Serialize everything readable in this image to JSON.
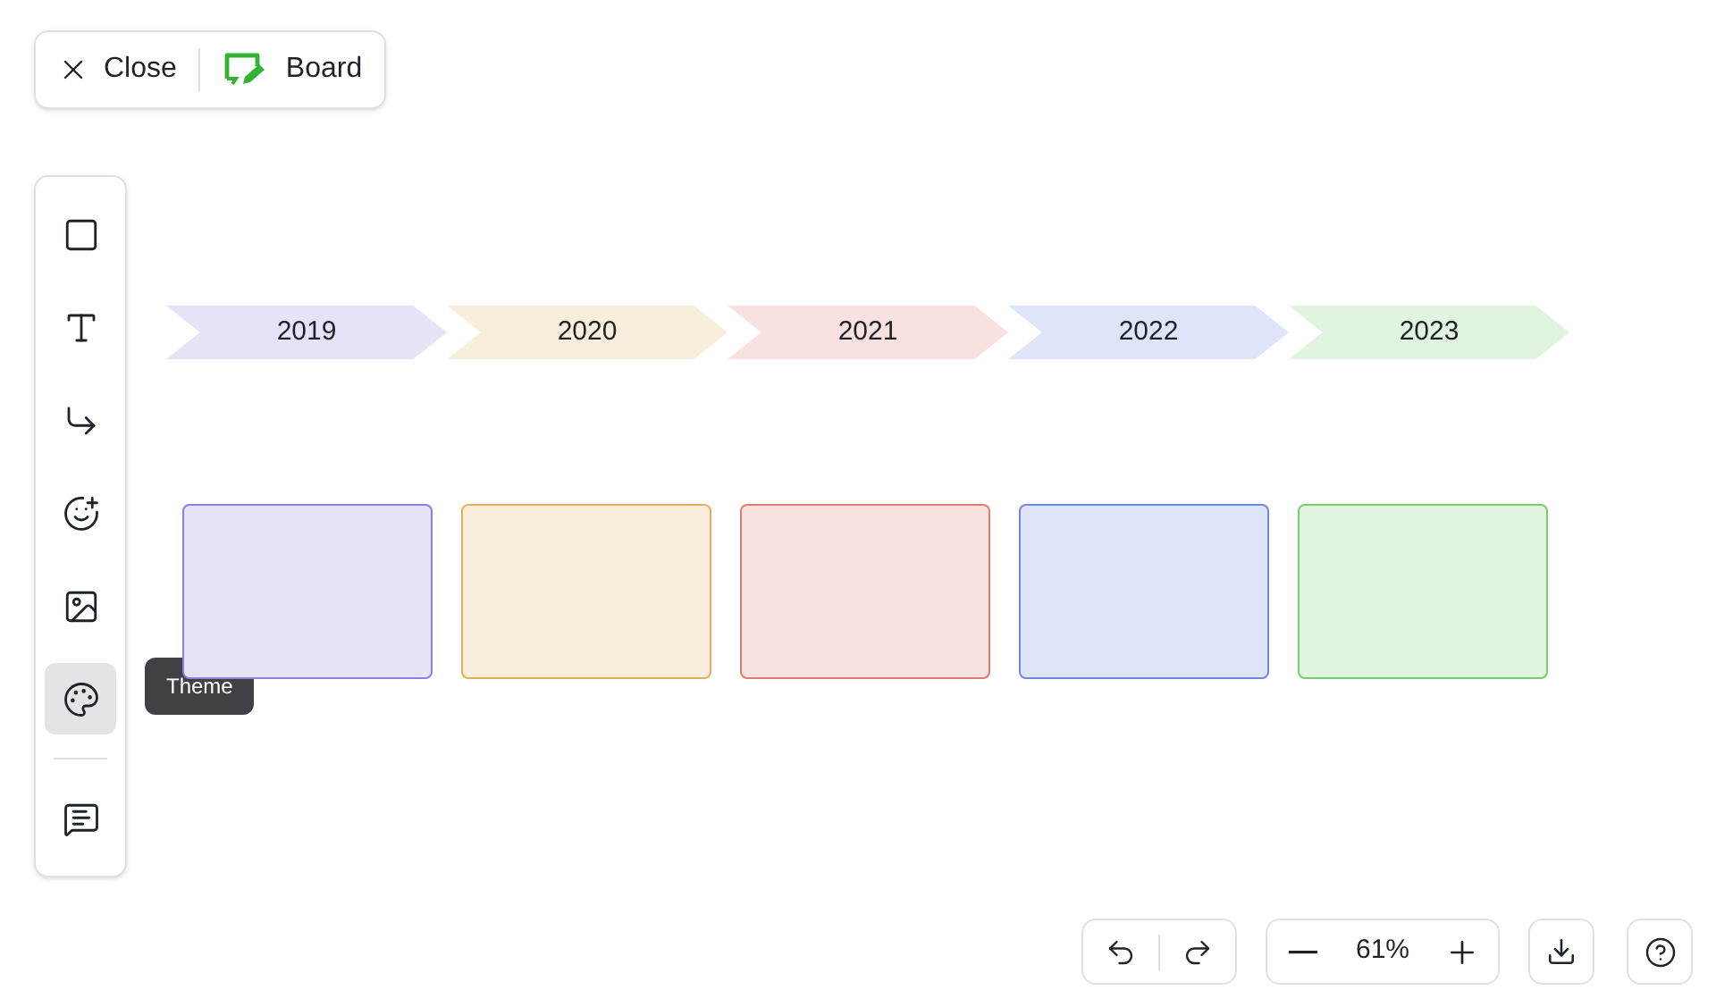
{
  "header": {
    "close_label": "Close",
    "title": "Board"
  },
  "tools": [
    {
      "kind": "shape",
      "selected": false
    },
    {
      "kind": "text",
      "selected": false
    },
    {
      "kind": "connector",
      "selected": false
    },
    {
      "kind": "sticker",
      "selected": false
    },
    {
      "kind": "image",
      "selected": false
    },
    {
      "kind": "theme",
      "selected": true
    }
  ],
  "bottom_tools": [
    {
      "kind": "comment",
      "selected": false
    }
  ],
  "tooltip": "Theme",
  "timeline": [
    {
      "year": "2019",
      "color": "#8f7ee0"
    },
    {
      "year": "2020",
      "color": "#e3ad5c"
    },
    {
      "year": "2021",
      "color": "#de7b73"
    },
    {
      "year": "2022",
      "color": "#6f87de"
    },
    {
      "year": "2023",
      "color": "#74cf6d"
    }
  ],
  "zoom": {
    "value": "61%"
  }
}
